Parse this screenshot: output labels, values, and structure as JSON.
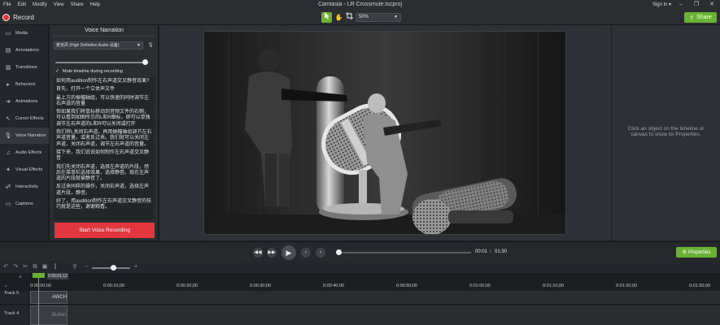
{
  "menubar": {
    "items": [
      "File",
      "Edit",
      "Modify",
      "View",
      "Share",
      "Help"
    ],
    "title": "Camtasia - LR Crossmute.tscproj",
    "signin": "Sign in ▾",
    "minimize": "–",
    "maximize": "❐",
    "close": "✕"
  },
  "toolbar": {
    "record_label": "Record",
    "zoom_value": "50%",
    "share_label": "Share"
  },
  "leftnav": {
    "items": [
      {
        "label": "Media",
        "icon": "film-icon"
      },
      {
        "label": "Annotations",
        "icon": "annotation-icon"
      },
      {
        "label": "Transitions",
        "icon": "transition-icon"
      },
      {
        "label": "Behaviors",
        "icon": "behavior-icon"
      },
      {
        "label": "Animations",
        "icon": "animation-icon"
      },
      {
        "label": "Cursor Effects",
        "icon": "cursor-icon"
      },
      {
        "label": "Voice Narration",
        "icon": "mic-icon"
      },
      {
        "label": "Audio Effects",
        "icon": "audio-icon"
      },
      {
        "label": "Visual Effects",
        "icon": "visual-fx-icon"
      },
      {
        "label": "Interactivity",
        "icon": "interactivity-icon"
      },
      {
        "label": "Captions",
        "icon": "captions-icon"
      }
    ],
    "active_index": 6
  },
  "panel": {
    "title": "Voice Narration",
    "device": "麦克风 (High Definition Audio 设备)",
    "volume_level": 0.97,
    "mute_label": "Mute timeline during recording",
    "mute_checked": true,
    "script": [
      "如何用audition制作左右声道交叉静音效果?",
      "首先，打开一个立体声文件",
      "最上方的振幅轴组，可以快速的同时调节左右声道的音量",
      "但如果我们将鼠标移动到音频文件的右侧，可以看到如图所示的L和R图标，即可以单独调节左右声道的L和R可以关闭或打开",
      "我们将L关闭右声道，再用振幅轴组调节左右声道音量，或者反过来。我们就可以关闭左声道，关闭右声道，调节左右声道的音量。",
      "接下来，我们说说如何制作左右声道交叉静音",
      "我们先关闭右声道，选择左声道的片段，然后在菜单栏选择效果，选择静音。现在左声道的片段就被静音了。",
      "反过来同样的操作，关闭右声道，选择左声道片段，静音。",
      "好了，用audition制作左右声道交叉静音的技巧就是这些，谢谢观看。"
    ],
    "start_label": "Start Voice Recording"
  },
  "properties": {
    "hint": "Click an object on the timeline or canvas to show its Properties.",
    "button_label": "Properties"
  },
  "playback": {
    "current_time": "00:01",
    "separator": "/",
    "total_time": "01:30",
    "progress": 0.01
  },
  "timeline": {
    "playhead_time": "0:00:01;12",
    "ticks": [
      "0:00:00;00",
      "0:00:10;00",
      "0:00:20;00",
      "0:00:30;00",
      "0:00:40;00",
      "0:00:50;00",
      "0:01:00;00",
      "0:01:10;00",
      "0:01:20;00",
      "0:01:30;00"
    ],
    "tracks": [
      {
        "label": "Track 5",
        "clip": "AWCH"
      },
      {
        "label": "Track 4",
        "clip": "ButtonMode"
      }
    ]
  },
  "colors": {
    "accent_green": "#6bb234",
    "record_red": "#e2373f"
  }
}
